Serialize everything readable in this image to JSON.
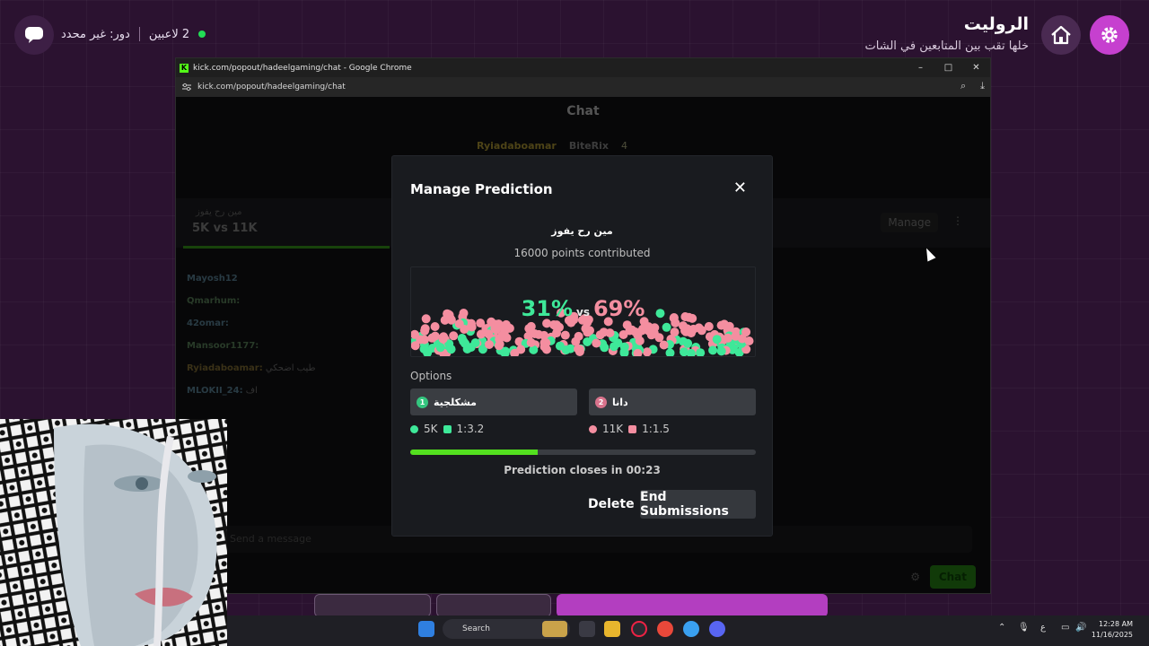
{
  "game": {
    "title": "الروليت",
    "subtitle": "خلها تقب بين المتابعين في الشات",
    "players": "2 لاعبين",
    "role": "دور: غير محدد"
  },
  "browser": {
    "window_title": "kick.com/popout/hadeelgaming/chat - Google Chrome",
    "url": "kick.com/popout/hadeelgaming/chat",
    "controls": {
      "minimize": "–",
      "maximize": "□",
      "close": "✕"
    }
  },
  "chat": {
    "header": "Chat",
    "pinned_user_1": "Ryiadaboamar",
    "pinned_user_2": "BiteRix",
    "pinned_count": "4",
    "prediction_question": "مين رح يفوز",
    "prediction_values": "5K vs 11K",
    "manage_label": "Manage",
    "lines": [
      {
        "name": "Mayosh12",
        "text": ""
      },
      {
        "name": "Qmarhum:",
        "text": ""
      },
      {
        "name": "42omar:",
        "text": ""
      },
      {
        "name": "Mansoor1177:",
        "text": ""
      },
      {
        "name": "Ryiadaboamar:",
        "text": "طيب اضحكي"
      },
      {
        "name": "MLOKII_24:",
        "text": "اف"
      }
    ],
    "input_placeholder": "Send a message",
    "chat_button": "Chat"
  },
  "modal": {
    "title": "Manage Prediction",
    "close_icon": "✕",
    "question": "مين رح يفوز",
    "points_contributed": "16000 points contributed",
    "pct_a": "31%",
    "vs": "vs",
    "pct_b": "69%",
    "options_label": "Options",
    "option_a": {
      "num": "1",
      "label": "مشكلجية",
      "points": "5K",
      "ratio": "1:3.2",
      "color": "#3ee899"
    },
    "option_b": {
      "num": "2",
      "label": "دانا",
      "points": "11K",
      "ratio": "1:1.5",
      "color": "#f48ea0"
    },
    "progress": 0.37,
    "closes_text": "Prediction closes in 00:23",
    "delete_label": "Delete",
    "end_label": "End Submissions"
  },
  "taskbar": {
    "search_label": "Search",
    "time": "12:28 AM",
    "date": "11/16/2025",
    "lang": "ع"
  }
}
